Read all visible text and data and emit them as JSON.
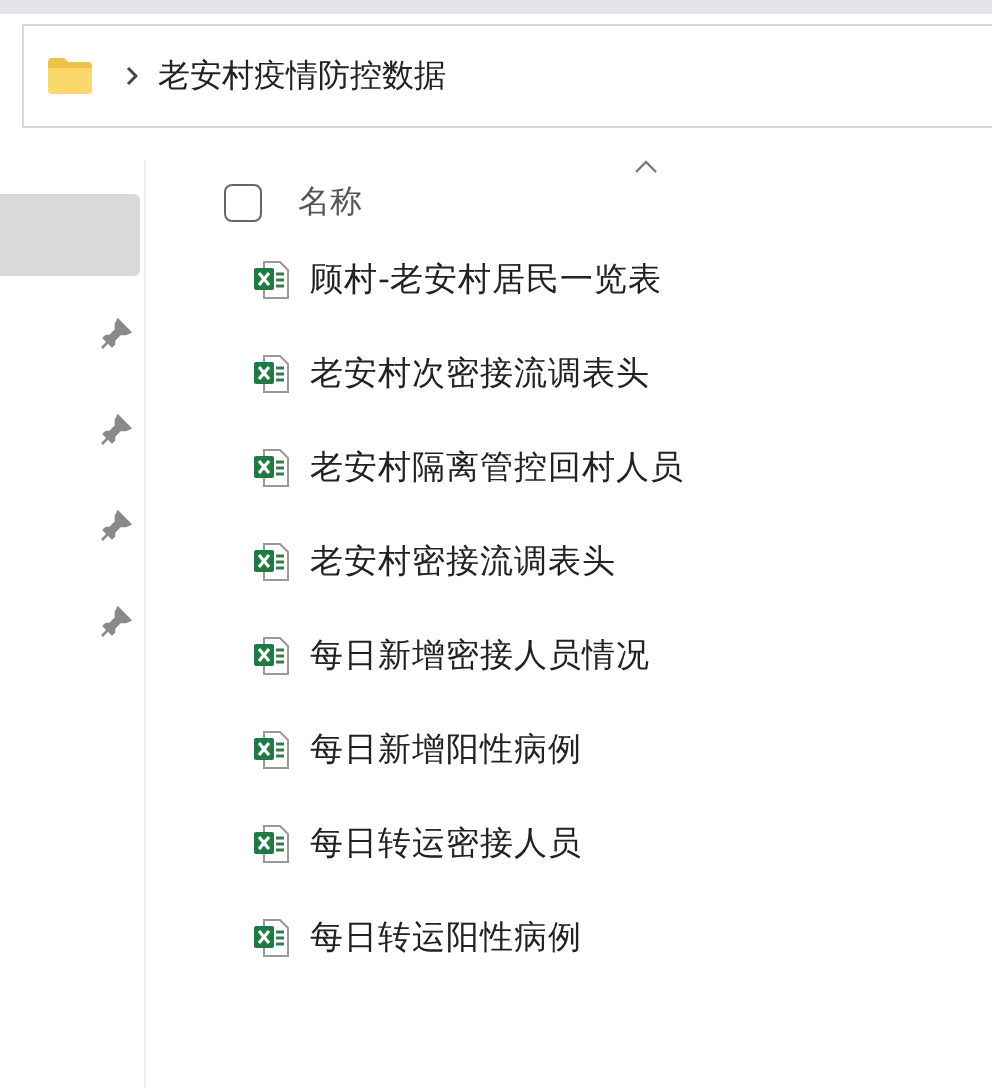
{
  "address_bar": {
    "path": "老安村疫情防控数据"
  },
  "file_list": {
    "header": {
      "label": "名称",
      "checked": false
    },
    "files": [
      {
        "name": "顾村-老安村居民一览表",
        "kind": "excel"
      },
      {
        "name": "老安村次密接流调表头",
        "kind": "excel"
      },
      {
        "name": "老安村隔离管控回村人员",
        "kind": "excel"
      },
      {
        "name": "老安村密接流调表头",
        "kind": "excel"
      },
      {
        "name": "每日新增密接人员情况",
        "kind": "excel"
      },
      {
        "name": "每日新增阳性病例",
        "kind": "excel"
      },
      {
        "name": "每日转运密接人员",
        "kind": "excel"
      },
      {
        "name": "每日转运阳性病例",
        "kind": "excel"
      }
    ]
  }
}
